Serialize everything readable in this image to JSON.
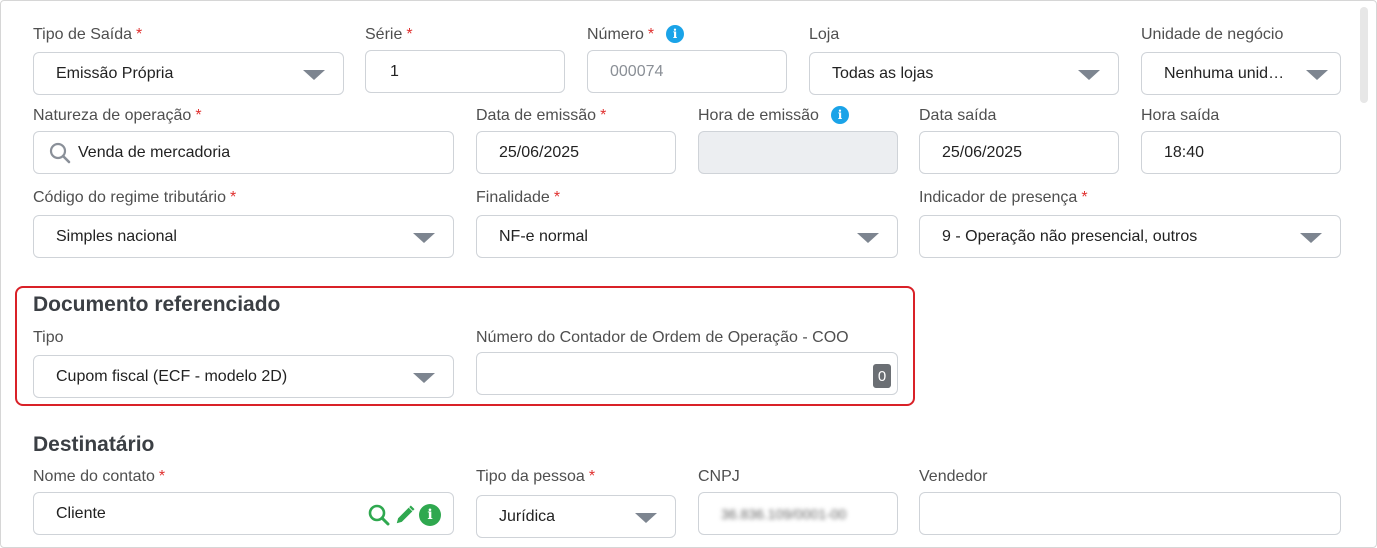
{
  "form": {
    "tipo_saida": {
      "label": "Tipo de Saída",
      "required": "*",
      "value": "Emissão Própria"
    },
    "serie": {
      "label": "Série",
      "required": "*",
      "value": "1"
    },
    "numero": {
      "label": "Número",
      "required": "*",
      "placeholder": "000074"
    },
    "loja": {
      "label": "Loja",
      "value": "Todas as lojas"
    },
    "unidade_negocio": {
      "label": "Unidade de negócio",
      "value": "Nenhuma unid…"
    },
    "natureza_operacao": {
      "label": "Natureza de operação",
      "required": "*",
      "value": "Venda de mercadoria"
    },
    "data_emissao": {
      "label": "Data de emissão",
      "required": "*",
      "value": "25/06/2025"
    },
    "hora_emissao": {
      "label": "Hora de emissão",
      "value": ""
    },
    "data_saida": {
      "label": "Data saída",
      "value": "25/06/2025"
    },
    "hora_saida": {
      "label": "Hora saída",
      "value": "18:40"
    },
    "regime_tributario": {
      "label": "Código do regime tributário",
      "required": "*",
      "value": "Simples nacional"
    },
    "finalidade": {
      "label": "Finalidade",
      "required": "*",
      "value": "NF-e normal"
    },
    "indicador_presenca": {
      "label": "Indicador de presença",
      "required": "*",
      "value": "9 - Operação não presencial, outros"
    }
  },
  "documento_referenciado": {
    "title": "Documento referenciado",
    "tipo": {
      "label": "Tipo",
      "value": "Cupom fiscal (ECF - modelo 2D)"
    },
    "coo": {
      "label": "Número do Contador de Ordem de Operação - COO",
      "value": "",
      "counter": "0"
    }
  },
  "destinatario": {
    "title": "Destinatário",
    "nome_contato": {
      "label": "Nome do contato",
      "required": "*",
      "value": "Cliente"
    },
    "tipo_pessoa": {
      "label": "Tipo da pessoa",
      "required": "*",
      "value": "Jurídica"
    },
    "cnpj": {
      "label": "CNPJ",
      "value": "36.836.109/0001-00"
    },
    "vendedor": {
      "label": "Vendedor",
      "value": ""
    }
  },
  "icons": {
    "info": "i",
    "accent_blue": "#1aa3e8",
    "action_green": "#2fa84f",
    "highlight_red": "#d92128"
  }
}
